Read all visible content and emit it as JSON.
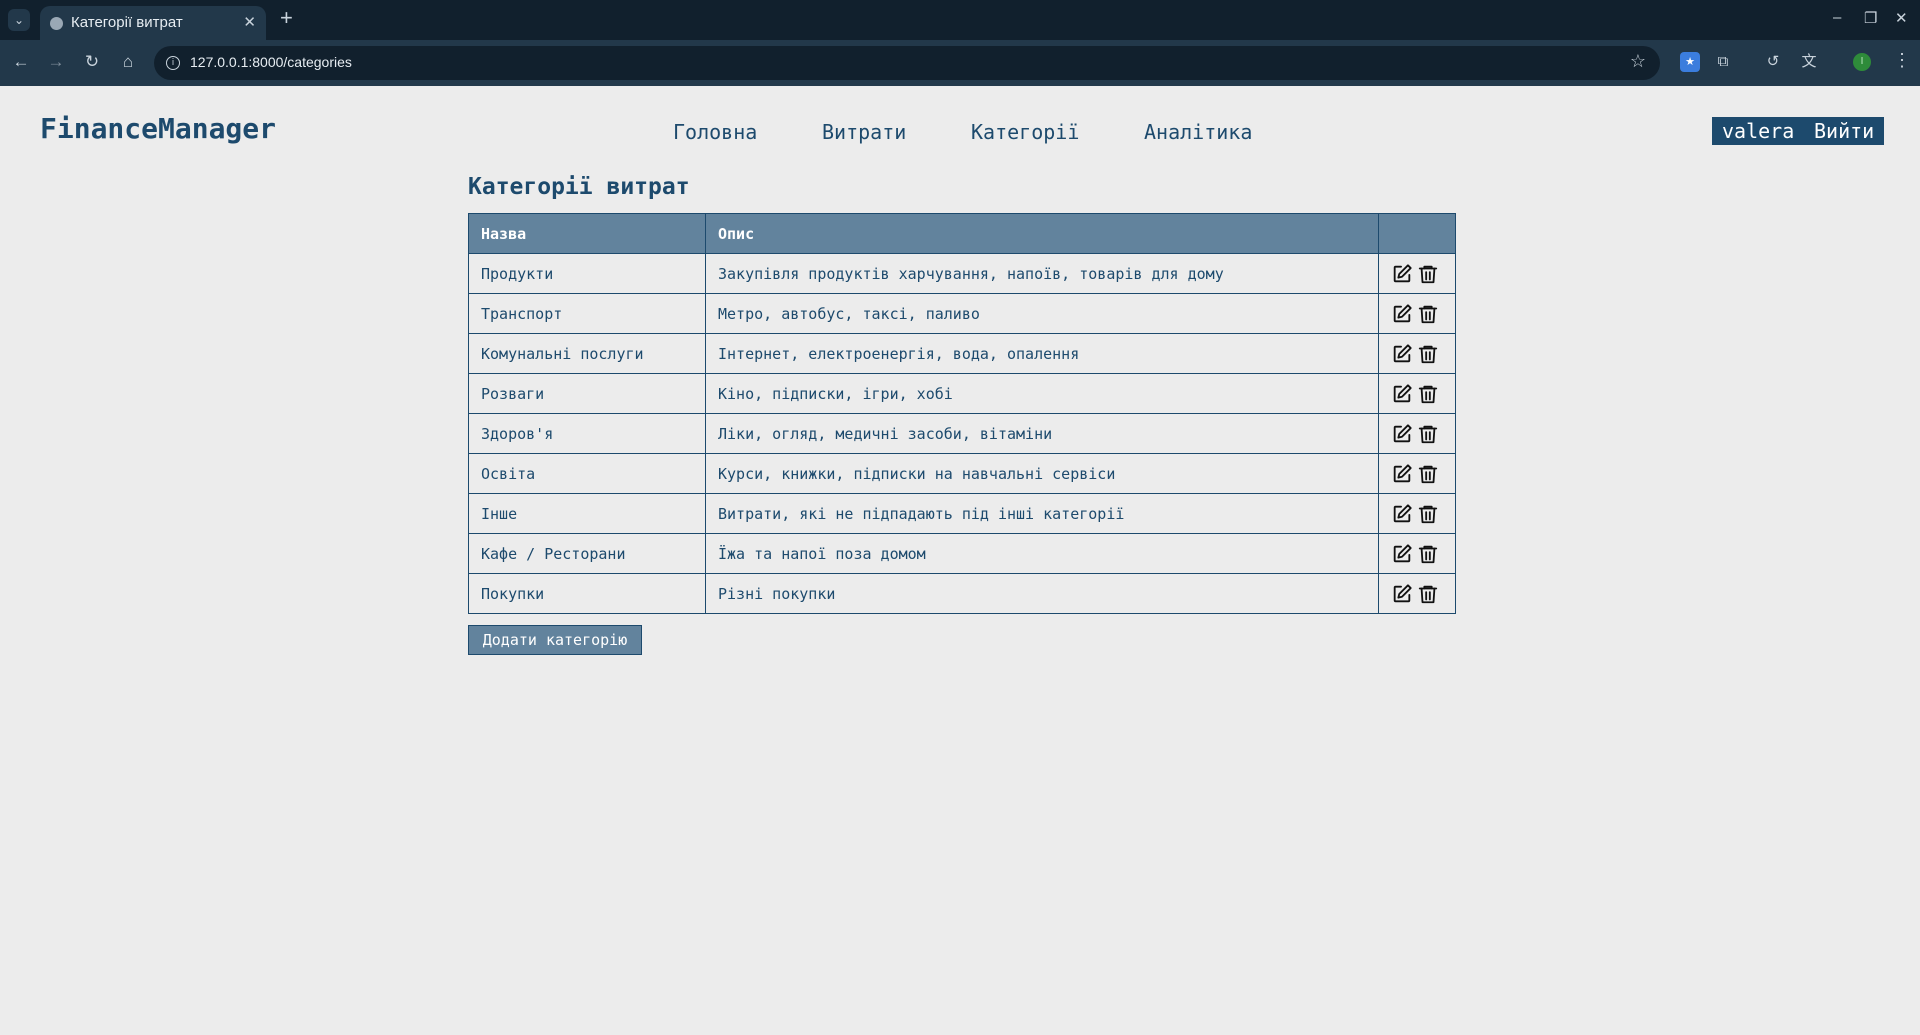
{
  "browser": {
    "tab_title": "Категорії витрат",
    "url": "127.0.0.1:8000/categories",
    "profile_initial": "I"
  },
  "header": {
    "brand": "FinanceManager",
    "nav": [
      "Головна",
      "Витрати",
      "Категорії",
      "Аналітика"
    ],
    "username": "valera",
    "logout": "Вийти"
  },
  "main": {
    "title": "Категорії витрат",
    "columns": [
      "Назва",
      "Опис",
      ""
    ],
    "rows": [
      {
        "name": "Продукти",
        "description": "Закупівля продуктів харчування, напоїв, товарів для дому"
      },
      {
        "name": "Транспорт",
        "description": "Метро, автобус, таксі, паливо"
      },
      {
        "name": "Комунальні послуги",
        "description": "Інтернет, електроенергія, вода, опалення"
      },
      {
        "name": "Розваги",
        "description": "Кіно, підписки, ігри, хобі"
      },
      {
        "name": "Здоров'я",
        "description": "Ліки, огляд, медичні засоби, вітаміни"
      },
      {
        "name": "Освіта",
        "description": "Курси, книжки, підписки на навчальні сервіси"
      },
      {
        "name": "Інше",
        "description": "Витрати, які не підпадають під інші категорії"
      },
      {
        "name": "Кафе / Ресторани",
        "description": "Їжа та напої поза домом"
      },
      {
        "name": "Покупки",
        "description": "Різні покупки"
      }
    ],
    "add_button": "Додати категорію"
  },
  "icons": {
    "edit": "edit-icon",
    "delete": "trash-icon"
  },
  "colors": {
    "brand": "#1d4a6d",
    "header_row": "#62839d",
    "background": "#ececec"
  }
}
